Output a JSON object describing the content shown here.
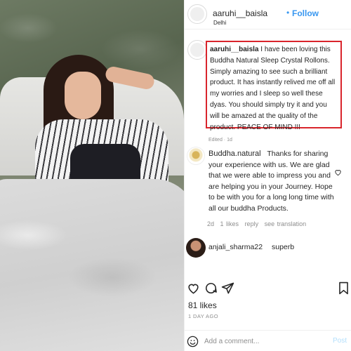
{
  "post": {
    "username": "aaruhi__baisla",
    "location": "Delhi",
    "follow_dot": "•",
    "follow_label": "Follow"
  },
  "caption": {
    "author": "aaruhi__baisla",
    "text": "I have been loving this Buddha Natural Sleep Crystal Rollons. Simply amazing to see such a brilliant product. It has instantly relived me off all my worries and I sleep so well these dyas. You should simply try it and you will be amazed at the quality of the product. PEACE OF MIND !!!",
    "meta": "Edited · 1d"
  },
  "reply": {
    "author": "Buddha.natural",
    "text": "Thanks for sharing your experience with us. We are glad that we were able to impress you and are helping you in your Journey. Hope to be with you for a long long time with all our buddha Products.",
    "time": "2d",
    "likes": "1 likes",
    "reply_label": "reply",
    "translation_label": "see translation"
  },
  "comment": {
    "author": "anjali_sharma22",
    "text": "superb"
  },
  "footer": {
    "likes": "81 likes",
    "time_ago": "1 DAY AGO",
    "comment_placeholder": "Add a comment...",
    "post_label": "Post"
  },
  "icons": {
    "like": "heart-icon",
    "comment": "comment-bubble-icon",
    "share": "paper-plane-icon",
    "save": "bookmark-icon",
    "emoji": "smiley-icon"
  },
  "colors": {
    "link_blue": "#3897f0",
    "highlight_red": "#d9252c",
    "muted_gray": "#8e8e8e",
    "post_disabled": "#b2dffc"
  }
}
